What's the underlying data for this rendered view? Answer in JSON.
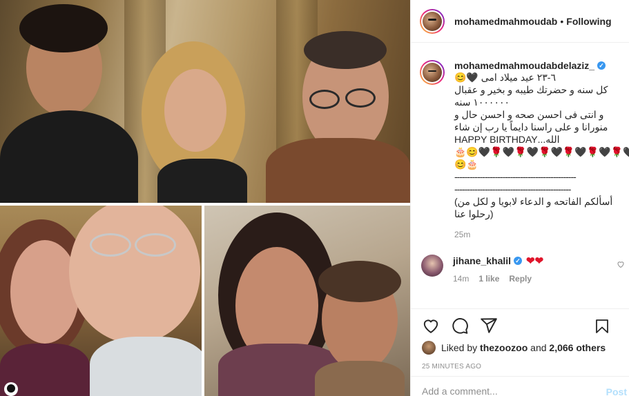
{
  "header": {
    "username": "mohamedmahmoudab",
    "separator": "•",
    "follow_status": "Following"
  },
  "caption": {
    "username": "mohamedmahmoudabdelaziz_",
    "verified_mark": "✓",
    "lines": [
      "٦-٢٣ عيد ميلاد امى 🖤😊",
      "كل سنه و حضرتك طيبه و بخير و عقبال",
      "١٠٠٠٠٠٠ سنه",
      "و انتى فى احسن صحه و احسن حال و",
      "منورانا و على راسنا دايماً يا رب إن شاء",
      "الله...HAPPY BIRTHDAY",
      "🎂😊🖤🌹🖤🌹🖤🌹🖤🌹🖤🌹🖤🌹🖤🌹",
      "😊🎂"
    ],
    "dashes": [
      "------------------------------------------------",
      "----------------------------------------------"
    ],
    "prayer_lines": [
      "أسألكم الفاتحه و الدعاء لابويا و لكل من)",
      "(رحلوا عنا"
    ],
    "time": "25m"
  },
  "comment": {
    "username": "jihane_khalil",
    "verified_mark": "✓",
    "text": "❤❤",
    "time": "14m",
    "likes": "1 like",
    "reply": "Reply"
  },
  "actions": {
    "like_icon": "heart-icon",
    "comment_icon": "comment-icon",
    "share_icon": "share-icon",
    "save_icon": "bookmark-icon"
  },
  "likes": {
    "prefix": "Liked by",
    "user": "thezoozoo",
    "and": "and",
    "others": "2,066 others"
  },
  "timestamp": "25 MINUTES AGO",
  "add_comment": {
    "placeholder": "Add a comment...",
    "post_label": "Post"
  },
  "colors": {
    "verified": "#3897f0",
    "heart": "#e0152b",
    "post_disabled": "#b2dffc",
    "meta_grey": "#8e8e8e"
  }
}
